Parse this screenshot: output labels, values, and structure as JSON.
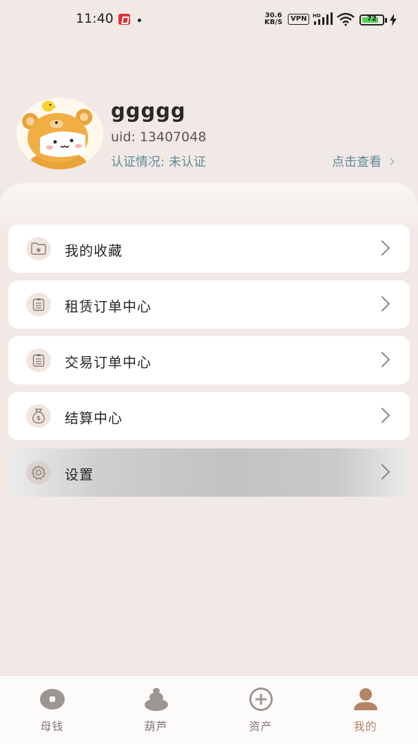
{
  "status_bar": {
    "time": "11:40",
    "net_speed_value": "30.6",
    "net_speed_unit": "KB/S",
    "vpn": "VPN",
    "battery": "72"
  },
  "profile": {
    "username": "ggggg",
    "uid": "uid: 13407048",
    "auth_label": "认证情况:",
    "auth_value": "未认证",
    "view_link": "点击查看"
  },
  "menu": {
    "items": [
      {
        "label": "我的收藏",
        "icon": "star-folder-icon"
      },
      {
        "label": "租赁订单中心",
        "icon": "clipboard-icon"
      },
      {
        "label": "交易订单中心",
        "icon": "clipboard-icon"
      },
      {
        "label": "结算中心",
        "icon": "money-bag-icon"
      },
      {
        "label": "设置",
        "icon": "gear-icon"
      }
    ]
  },
  "bottom_nav": {
    "items": [
      {
        "label": "母钱",
        "icon": "coin-icon"
      },
      {
        "label": "葫芦",
        "icon": "gourd-icon"
      },
      {
        "label": "资产",
        "icon": "plus-circle-icon"
      },
      {
        "label": "我的",
        "icon": "user-icon",
        "active": true
      }
    ]
  },
  "colors": {
    "background": "#f1e9e5",
    "accent_link": "#5e8a98",
    "active_tab": "#b58365"
  }
}
